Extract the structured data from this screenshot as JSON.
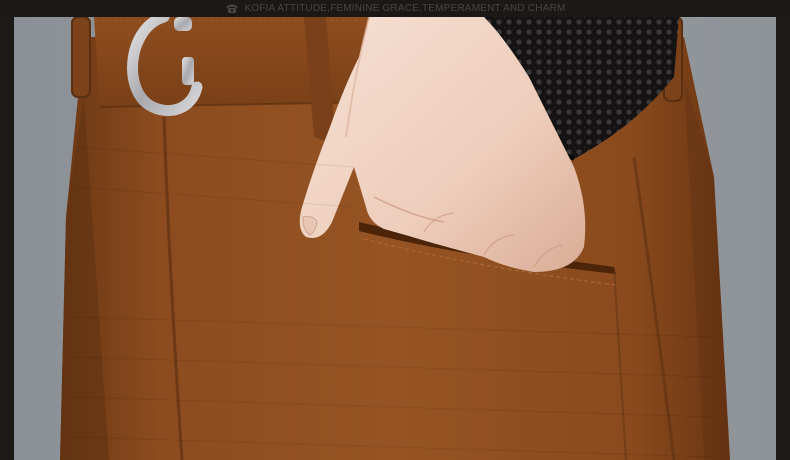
{
  "banner": {
    "icon": "telephone-icon",
    "text": "KOFIA ATTITUDE,FEMININE GRACE,TEMPERAMENT AND CHARM"
  },
  "photo": {
    "subject": "product-photo",
    "colors": {
      "background": "#8f9499",
      "fabric": "#8a4b1e",
      "fabric_shadow": "#5a2e10",
      "skin": "#f0d4c4",
      "lace": "#0e0d0e",
      "buckle": "#c9c9cc"
    }
  }
}
